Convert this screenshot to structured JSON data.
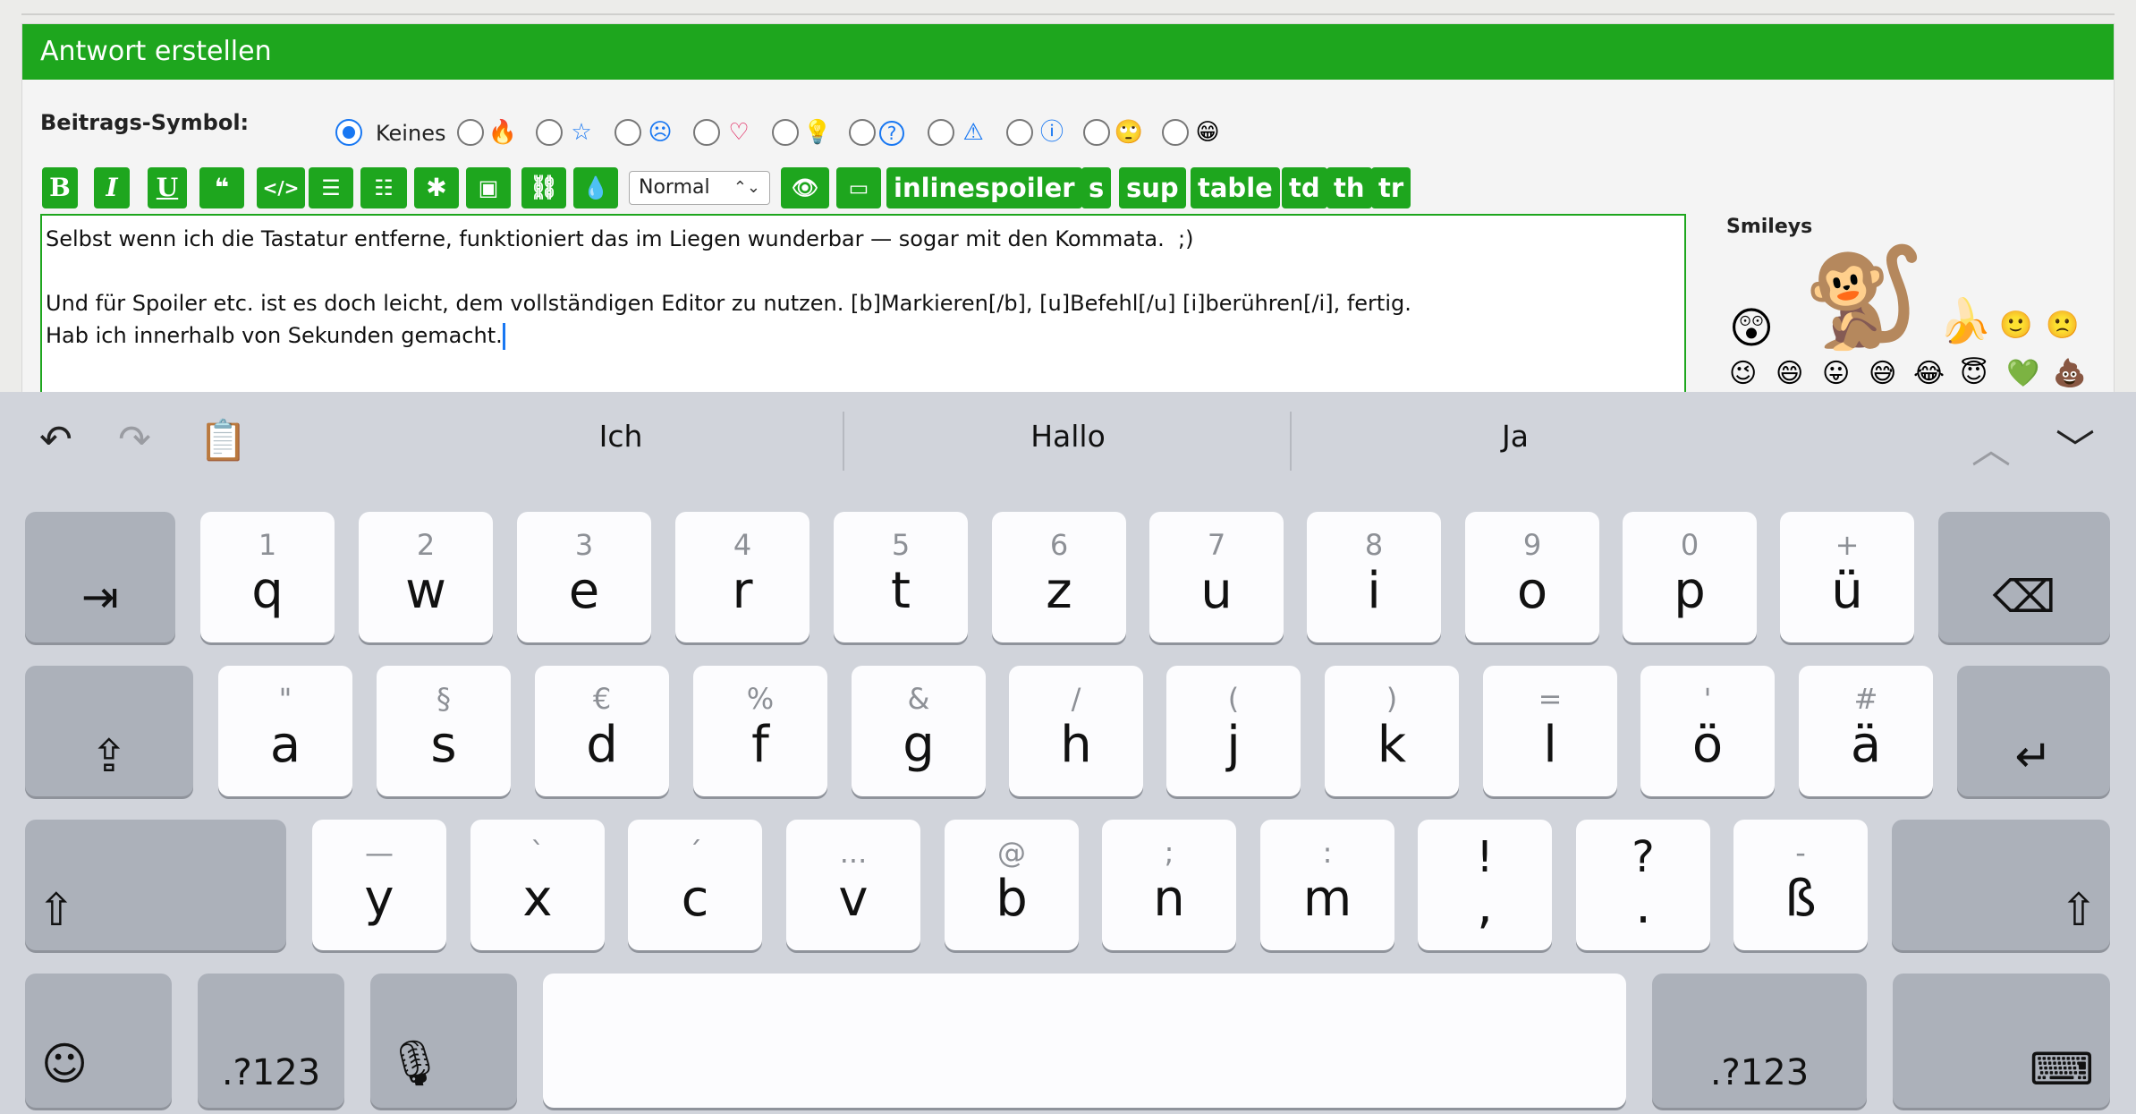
{
  "panel": {
    "title": "Antwort erstellen",
    "symbol_label": "Beitrags-Symbol:",
    "symbols": [
      {
        "name": "none",
        "label": "Keines",
        "selected": true
      },
      {
        "name": "flame-icon",
        "glyph": "🔥",
        "color": "#f39c12"
      },
      {
        "name": "star-icon",
        "glyph": "☆",
        "color": "#1877f2"
      },
      {
        "name": "dizzy-face-icon",
        "glyph": "☹",
        "color": "#1877f2"
      },
      {
        "name": "heart-icon",
        "glyph": "♡",
        "color": "#e0245e"
      },
      {
        "name": "lightbulb-icon",
        "glyph": "💡",
        "color": "#f1c40f"
      },
      {
        "name": "question-icon",
        "glyph": "?",
        "color": "#1877f2"
      },
      {
        "name": "warning-icon",
        "glyph": "⚠",
        "color": "#1877f2"
      },
      {
        "name": "info-icon",
        "glyph": "ⓘ",
        "color": "#1877f2"
      },
      {
        "name": "eyeroll-smiley-icon",
        "glyph": "🙄",
        "color": "#f1c40f"
      },
      {
        "name": "grin-smiley-icon",
        "glyph": "😁",
        "color": "#2ecc71"
      }
    ]
  },
  "toolbar": {
    "bold": "B",
    "italic": "I",
    "underline": "U",
    "size_select": "Normal",
    "inlinespoiler": "inlinespoiler",
    "s": "s",
    "sup": "sup",
    "table": "table",
    "td": "td",
    "th": "th",
    "tr": "tr"
  },
  "editor": {
    "line1": "Selbst wenn ich die Tastatur entferne, funktioniert das im Liegen wunderbar — sogar mit den Kommata.  ;)",
    "line2": "",
    "line3": "Und für Spoiler etc. ist es doch leicht, dem vollständigen Editor zu nutzen. [b]Markieren[/b], [u]Befehl[/u] [i]berühren[/i], fertig.",
    "line4": "Hab ich innerhalb von Sekunden gemacht."
  },
  "smileys": {
    "title": "Smileys",
    "items": [
      "😲",
      "🐒",
      "🍌",
      "🙂",
      "🙁",
      "😉",
      "😄",
      "😛",
      "😅",
      "😂",
      "😇",
      "💚",
      "💩"
    ]
  },
  "keyboard": {
    "predictions": [
      "Ich",
      "Hallo",
      "Ja"
    ],
    "row1": [
      {
        "sec": "1",
        "pri": "q"
      },
      {
        "sec": "2",
        "pri": "w"
      },
      {
        "sec": "3",
        "pri": "e"
      },
      {
        "sec": "4",
        "pri": "r"
      },
      {
        "sec": "5",
        "pri": "t"
      },
      {
        "sec": "6",
        "pri": "z"
      },
      {
        "sec": "7",
        "pri": "u"
      },
      {
        "sec": "8",
        "pri": "i"
      },
      {
        "sec": "9",
        "pri": "o"
      },
      {
        "sec": "0",
        "pri": "p"
      },
      {
        "sec": "+",
        "pri": "ü"
      }
    ],
    "row2": [
      {
        "sec": "\"",
        "pri": "a"
      },
      {
        "sec": "§",
        "pri": "s"
      },
      {
        "sec": "€",
        "pri": "d"
      },
      {
        "sec": "%",
        "pri": "f"
      },
      {
        "sec": "&",
        "pri": "g"
      },
      {
        "sec": "/",
        "pri": "h"
      },
      {
        "sec": "(",
        "pri": "j"
      },
      {
        "sec": ")",
        "pri": "k"
      },
      {
        "sec": "=",
        "pri": "l"
      },
      {
        "sec": "'",
        "pri": "ö"
      },
      {
        "sec": "#",
        "pri": "ä"
      }
    ],
    "row3": [
      {
        "sec": "—",
        "pri": "y"
      },
      {
        "sec": "`",
        "pri": "x"
      },
      {
        "sec": "´",
        "pri": "c"
      },
      {
        "sec": "...",
        "pri": "v"
      },
      {
        "sec": "@",
        "pri": "b"
      },
      {
        "sec": ";",
        "pri": "n"
      },
      {
        "sec": ":",
        "pri": "m"
      },
      {
        "sec": "!",
        "pri": ","
      },
      {
        "sec": "?",
        "pri": "."
      },
      {
        "sec": "-",
        "pri": "ß"
      }
    ],
    "numbers_label": ".?123"
  }
}
